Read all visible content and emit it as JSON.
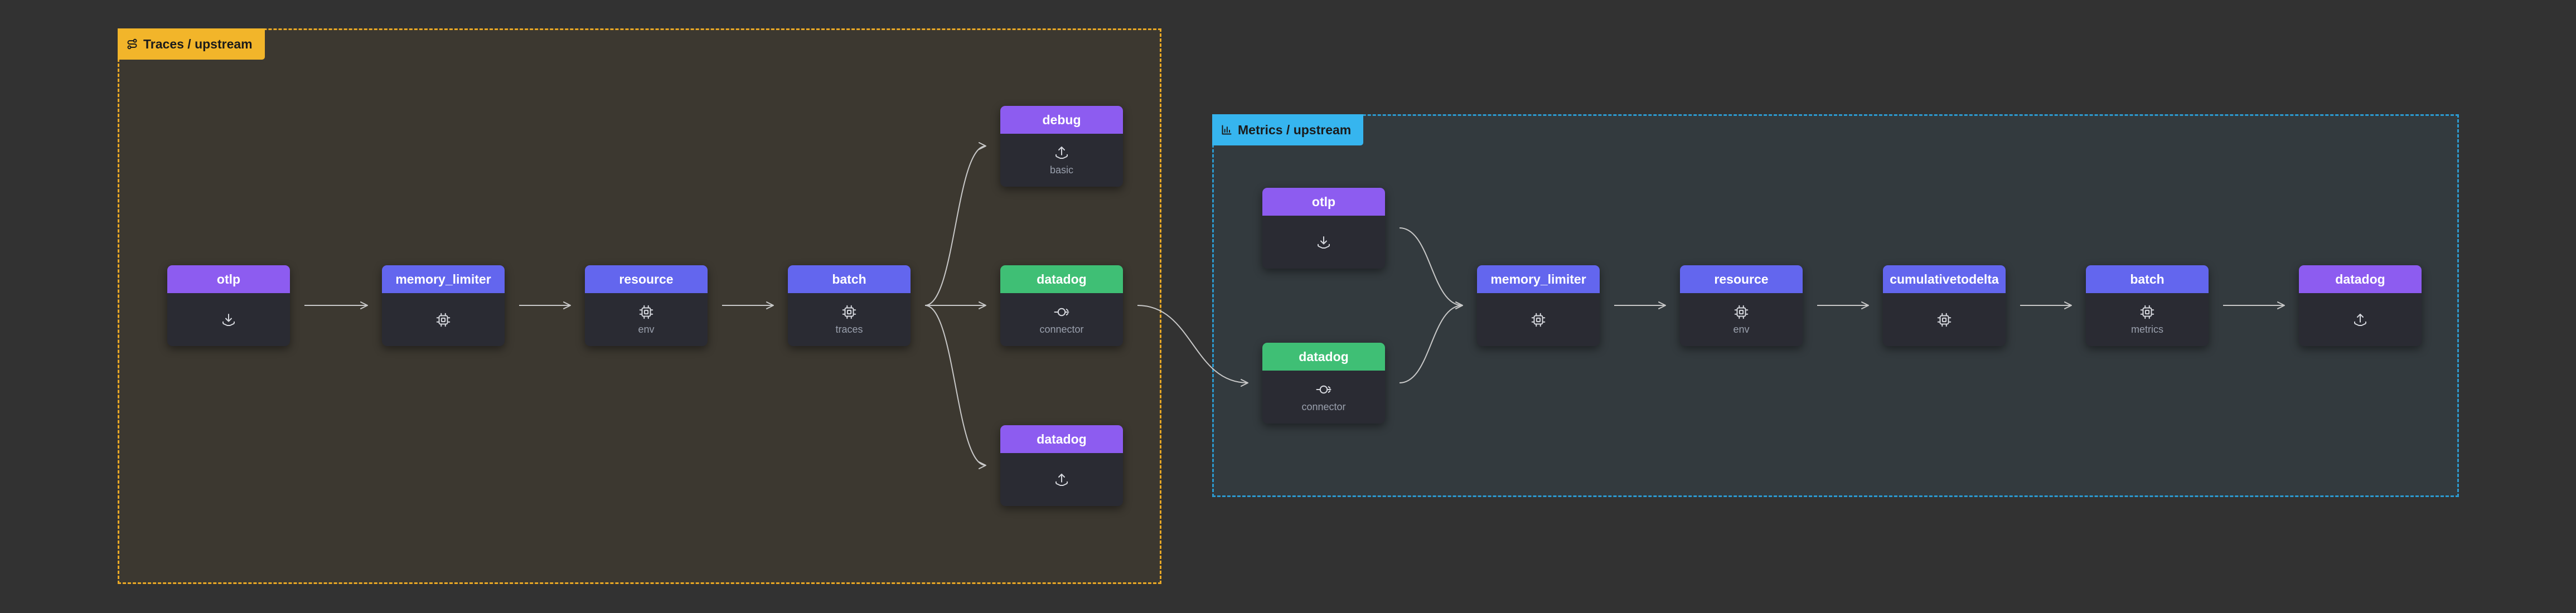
{
  "colors": {
    "canvas_bg": "#323232",
    "traces_group_border": "#e9a825",
    "metrics_group_border": "#2b9ad0",
    "receiver_exporter": "#8d5cf0",
    "processor": "#6366ee",
    "connector": "#3fbf75",
    "edge": "#c8c8c8"
  },
  "groups": {
    "traces": {
      "label": "Traces / upstream",
      "icon": "route-icon"
    },
    "metrics": {
      "label": "Metrics / upstream",
      "icon": "bar-chart-icon"
    }
  },
  "nodes": {
    "t_otlp": {
      "title": "otlp",
      "kind": "receiver",
      "icon": "download-icon",
      "sub": ""
    },
    "t_memory_limiter": {
      "title": "memory_limiter",
      "kind": "processor",
      "icon": "cpu-icon",
      "sub": ""
    },
    "t_resource": {
      "title": "resource",
      "kind": "processor",
      "icon": "cpu-icon",
      "sub": "env"
    },
    "t_batch": {
      "title": "batch",
      "kind": "processor",
      "icon": "cpu-icon",
      "sub": "traces"
    },
    "t_debug": {
      "title": "debug",
      "kind": "exporter",
      "icon": "upload-icon",
      "sub": "basic"
    },
    "t_datadog_conn": {
      "title": "datadog",
      "kind": "connector",
      "icon": "connector-icon",
      "sub": "connector"
    },
    "t_datadog_exp": {
      "title": "datadog",
      "kind": "exporter",
      "icon": "upload-icon",
      "sub": ""
    },
    "m_otlp": {
      "title": "otlp",
      "kind": "receiver",
      "icon": "download-icon",
      "sub": ""
    },
    "m_datadog_conn": {
      "title": "datadog",
      "kind": "connector",
      "icon": "connector-icon",
      "sub": "connector"
    },
    "m_memory_limiter": {
      "title": "memory_limiter",
      "kind": "processor",
      "icon": "cpu-icon",
      "sub": ""
    },
    "m_resource": {
      "title": "resource",
      "kind": "processor",
      "icon": "cpu-icon",
      "sub": "env"
    },
    "m_cumulativetodelta": {
      "title": "cumulativetodelta",
      "kind": "processor",
      "icon": "cpu-icon",
      "sub": ""
    },
    "m_batch": {
      "title": "batch",
      "kind": "processor",
      "icon": "cpu-icon",
      "sub": "metrics"
    },
    "m_datadog_exp": {
      "title": "datadog",
      "kind": "exporter",
      "icon": "upload-icon",
      "sub": ""
    }
  },
  "edges": [
    [
      "t_otlp",
      "t_memory_limiter"
    ],
    [
      "t_memory_limiter",
      "t_resource"
    ],
    [
      "t_resource",
      "t_batch"
    ],
    [
      "t_batch",
      "t_debug"
    ],
    [
      "t_batch",
      "t_datadog_conn"
    ],
    [
      "t_batch",
      "t_datadog_exp"
    ],
    [
      "t_datadog_conn",
      "m_datadog_conn"
    ],
    [
      "m_otlp",
      "m_memory_limiter"
    ],
    [
      "m_datadog_conn",
      "m_memory_limiter"
    ],
    [
      "m_memory_limiter",
      "m_resource"
    ],
    [
      "m_resource",
      "m_cumulativetodelta"
    ],
    [
      "m_cumulativetodelta",
      "m_batch"
    ],
    [
      "m_batch",
      "m_datadog_exp"
    ]
  ]
}
